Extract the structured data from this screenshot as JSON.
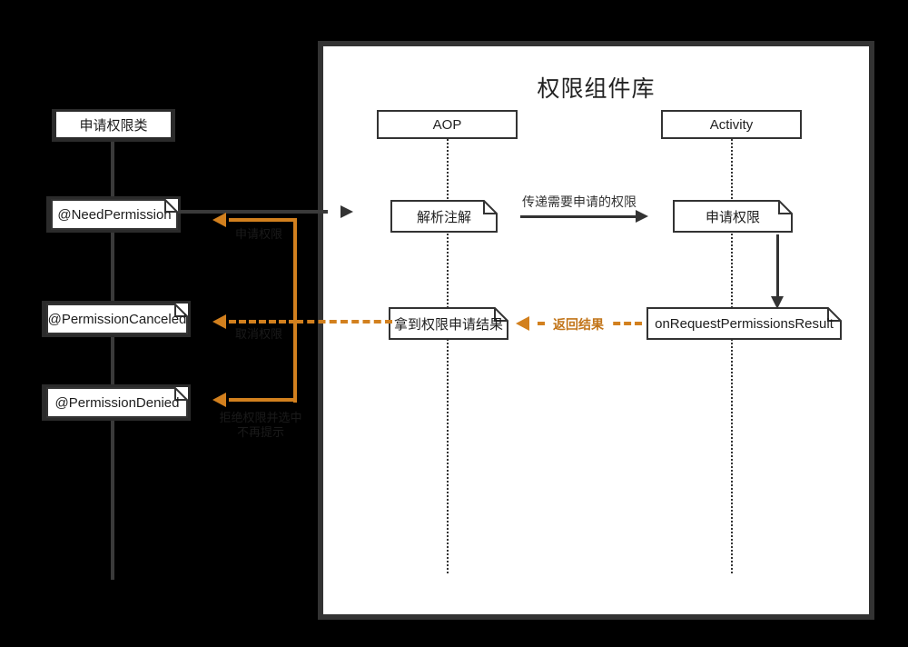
{
  "diagram": {
    "title": "权限组件库",
    "background_color": "#000000",
    "panel_color": "#ffffff",
    "accent_color": "#D2801E",
    "line_color": "#333333"
  },
  "left_column": {
    "root_box": {
      "label": "申请权限类"
    },
    "annotations": [
      {
        "label": "@NeedPermission"
      },
      {
        "label": "@PermissionCanceled"
      },
      {
        "label": "@PermissionDenied"
      }
    ]
  },
  "callback_labels": [
    {
      "label": "申请权限"
    },
    {
      "label": "取消权限"
    },
    {
      "label": "拒绝权限并选中",
      "label2": "不再提示"
    }
  ],
  "panel": {
    "actors": [
      {
        "name": "AOP"
      },
      {
        "name": "Activity"
      }
    ],
    "notes": [
      {
        "label": "解析注解"
      },
      {
        "label": "申请权限"
      },
      {
        "label": "拿到权限申请结果"
      },
      {
        "label": "onRequestPermissionsResult"
      }
    ],
    "edges": [
      {
        "label": "传递需要申请的权限"
      },
      {
        "label": "返回结果"
      }
    ]
  }
}
